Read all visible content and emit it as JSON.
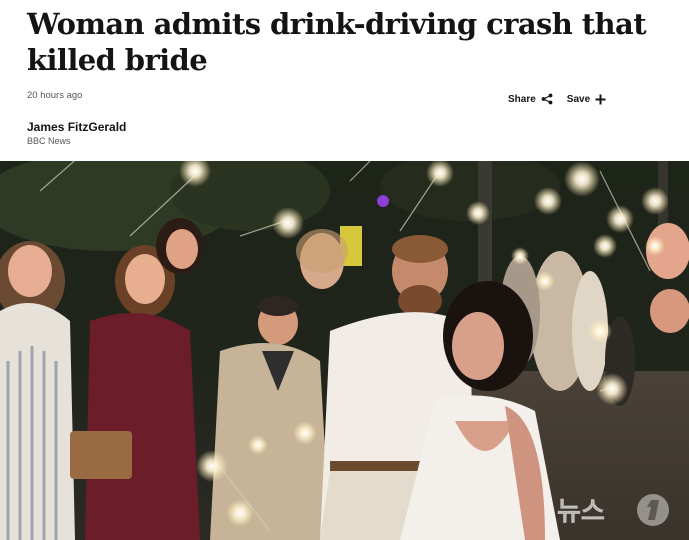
{
  "article": {
    "headline": "Woman admits drink-driving crash that killed bride",
    "timestamp": "20 hours ago",
    "author": "James FitzGerald",
    "source": "BBC News"
  },
  "actions": {
    "share_label": "Share",
    "save_label": "Save"
  },
  "image": {
    "description_icon": "wedding-sparkler-photo",
    "watermark_text": "뉴스1"
  },
  "colors": {
    "text": "#141414",
    "meta": "#545658",
    "photo_bg": "#1a1c16"
  }
}
